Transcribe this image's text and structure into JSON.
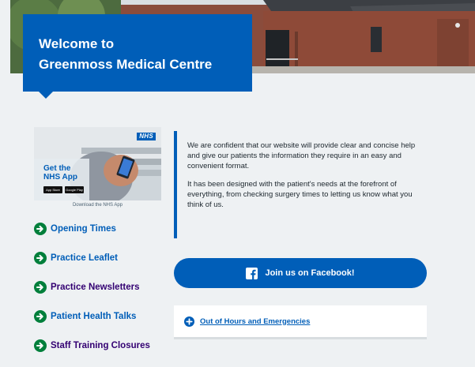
{
  "hero": {
    "title_line1": "Welcome to",
    "title_line2": "Greenmoss Medical Centre"
  },
  "app_promo": {
    "nhs_logo": "NHS",
    "headline_line1": "Get the",
    "headline_line2": "NHS App",
    "badge_app_store": "App Store",
    "badge_google_play": "Google Play",
    "caption": "Download the NHS App"
  },
  "side_links": [
    {
      "label": "Opening Times",
      "icon": "arrow-right-circle-icon"
    },
    {
      "label": "Practice Leaflet",
      "icon": "arrow-right-circle-icon"
    },
    {
      "label": "Practice Newsletters",
      "icon": "arrow-right-circle-icon"
    },
    {
      "label": "Patient Health Talks",
      "icon": "arrow-right-circle-icon"
    },
    {
      "label": "Staff Training Closures",
      "icon": "arrow-right-circle-icon"
    }
  ],
  "intro": {
    "paragraph1": "We are confident that our website will provide clear and concise help and give our patients the information they require in an easy and convenient format.",
    "paragraph2": "It has been designed with the patient's needs at the forefront of everything, from checking surgery times to letting us know what you think of us."
  },
  "facebook": {
    "label": "Join us on Facebook!",
    "icon": "facebook-icon"
  },
  "emergencies": {
    "label": "Out of Hours and Emergencies",
    "icon": "plus-circle-icon"
  },
  "colors": {
    "nhs_blue": "#005eb8",
    "nhs_green": "#007f3b",
    "visited_purple": "#330072",
    "background": "#eef1f3"
  }
}
